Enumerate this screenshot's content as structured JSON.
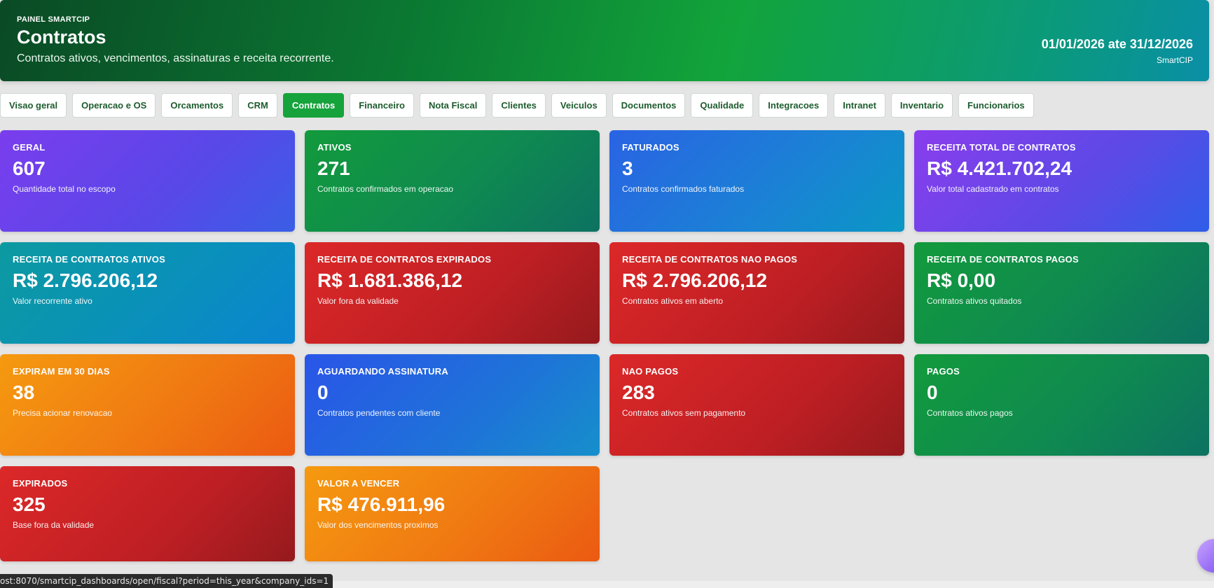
{
  "header": {
    "eyebrow": "PAINEL SMARTCIP",
    "title": "Contratos",
    "subtitle": "Contratos ativos, vencimentos, assinaturas e receita recorrente.",
    "period": "01/01/2026 ate 31/12/2026",
    "company": "SmartCIP"
  },
  "tabs": [
    {
      "label": "Visao geral",
      "active": false
    },
    {
      "label": "Operacao e OS",
      "active": false
    },
    {
      "label": "Orcamentos",
      "active": false
    },
    {
      "label": "CRM",
      "active": false
    },
    {
      "label": "Contratos",
      "active": true
    },
    {
      "label": "Financeiro",
      "active": false
    },
    {
      "label": "Nota Fiscal",
      "active": false
    },
    {
      "label": "Clientes",
      "active": false
    },
    {
      "label": "Veiculos",
      "active": false
    },
    {
      "label": "Documentos",
      "active": false
    },
    {
      "label": "Qualidade",
      "active": false
    },
    {
      "label": "Integracoes",
      "active": false
    },
    {
      "label": "Intranet",
      "active": false
    },
    {
      "label": "Inventario",
      "active": false
    },
    {
      "label": "Funcionarios",
      "active": false
    }
  ],
  "cards": [
    {
      "label": "GERAL",
      "value": "607",
      "desc": "Quantidade total no escopo"
    },
    {
      "label": "ATIVOS",
      "value": "271",
      "desc": "Contratos confirmados em operacao"
    },
    {
      "label": "FATURADOS",
      "value": "3",
      "desc": "Contratos confirmados faturados"
    },
    {
      "label": "RECEITA TOTAL DE CONTRATOS",
      "value": "R$ 4.421.702,24",
      "desc": "Valor total cadastrado em contratos"
    },
    {
      "label": "RECEITA DE CONTRATOS ATIVOS",
      "value": "R$ 2.796.206,12",
      "desc": "Valor recorrente ativo"
    },
    {
      "label": "RECEITA DE CONTRATOS EXPIRADOS",
      "value": "R$ 1.681.386,12",
      "desc": "Valor fora da validade"
    },
    {
      "label": "RECEITA DE CONTRATOS NAO PAGOS",
      "value": "R$ 2.796.206,12",
      "desc": "Contratos ativos em aberto"
    },
    {
      "label": "RECEITA DE CONTRATOS PAGOS",
      "value": "R$ 0,00",
      "desc": "Contratos ativos quitados"
    },
    {
      "label": "EXPIRAM EM 30 DIAS",
      "value": "38",
      "desc": "Precisa acionar renovacao"
    },
    {
      "label": "AGUARDANDO ASSINATURA",
      "value": "0",
      "desc": "Contratos pendentes com cliente"
    },
    {
      "label": "NAO PAGOS",
      "value": "283",
      "desc": "Contratos ativos sem pagamento"
    },
    {
      "label": "PAGOS",
      "value": "0",
      "desc": "Contratos ativos pagos"
    },
    {
      "label": "EXPIRADOS",
      "value": "325",
      "desc": "Base fora da validade"
    },
    {
      "label": "VALOR A VENCER",
      "value": "R$ 476.911,96",
      "desc": "Valor dos vencimentos proximos"
    }
  ],
  "statusbar": {
    "url": "ost:8070/smartcip_dashboards/open/fiscal?period=this_year&company_ids=1"
  }
}
